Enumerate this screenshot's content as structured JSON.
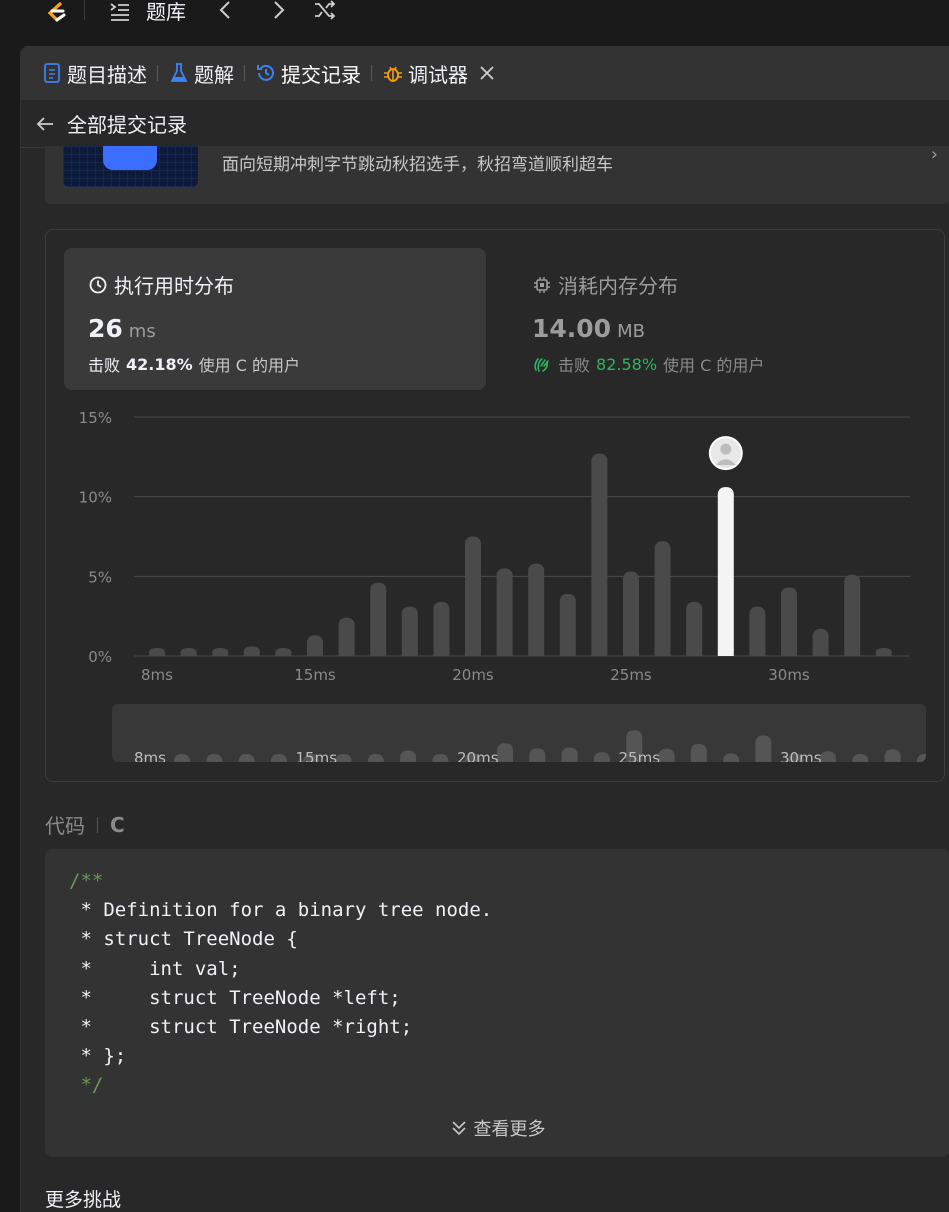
{
  "topbar": {
    "problem_bank": "题库"
  },
  "tabs": [
    {
      "label": "题目描述",
      "icon": "document-icon",
      "color": "#3b82f6"
    },
    {
      "label": "题解",
      "icon": "flask-icon",
      "color": "#3b82f6"
    },
    {
      "label": "提交记录",
      "icon": "history-icon",
      "color": "#3b82f6"
    },
    {
      "label": "调试器",
      "icon": "bug-icon",
      "color": "#f59e0b"
    }
  ],
  "subbar": {
    "back_label": "全部提交记录"
  },
  "banner": {
    "text": "面向短期冲刺字节跳动秋招选手，秋招弯道顺利超车"
  },
  "runtime": {
    "title": "执行用时分布",
    "value": "26",
    "unit": "ms",
    "beat_prefix": "击败",
    "beat_pct": "42.18%",
    "beat_suffix": "使用 C 的用户"
  },
  "memory": {
    "title": "消耗内存分布",
    "value": "14.00",
    "unit": "MB",
    "beat_prefix": "击败",
    "beat_pct": "82.58%",
    "beat_suffix": "使用 C 的用户"
  },
  "chart_data": {
    "type": "bar",
    "title": "",
    "xlabel": "",
    "ylabel": "",
    "y_ticks": [
      "15%",
      "10%",
      "5%",
      "0%"
    ],
    "ylim": [
      0,
      15
    ],
    "x": [
      8,
      9,
      10,
      11,
      12,
      13,
      14,
      15,
      16,
      17,
      18,
      19,
      20,
      21,
      22,
      23,
      24,
      25,
      26,
      27,
      28,
      29,
      30,
      31,
      32,
      33
    ],
    "values": [
      0.5,
      0.5,
      0.5,
      0.6,
      0.5,
      1.3,
      2.4,
      4.6,
      3.1,
      3.4,
      7.5,
      5.5,
      5.8,
      3.9,
      12.7,
      5.3,
      7.2,
      3.4,
      10.6,
      3.1,
      4.3,
      1.7,
      5.1,
      0.5,
      0,
      0
    ],
    "highlight_x": 26,
    "x_tick_labels": [
      "8ms",
      "15ms",
      "20ms",
      "25ms",
      "30ms"
    ],
    "x_tick_values": [
      8,
      13,
      18,
      23,
      28
    ],
    "grid": true
  },
  "code": {
    "label": "代码",
    "lang": "C",
    "see_more": "查看更多"
  },
  "more": {
    "title": "更多挑战"
  }
}
